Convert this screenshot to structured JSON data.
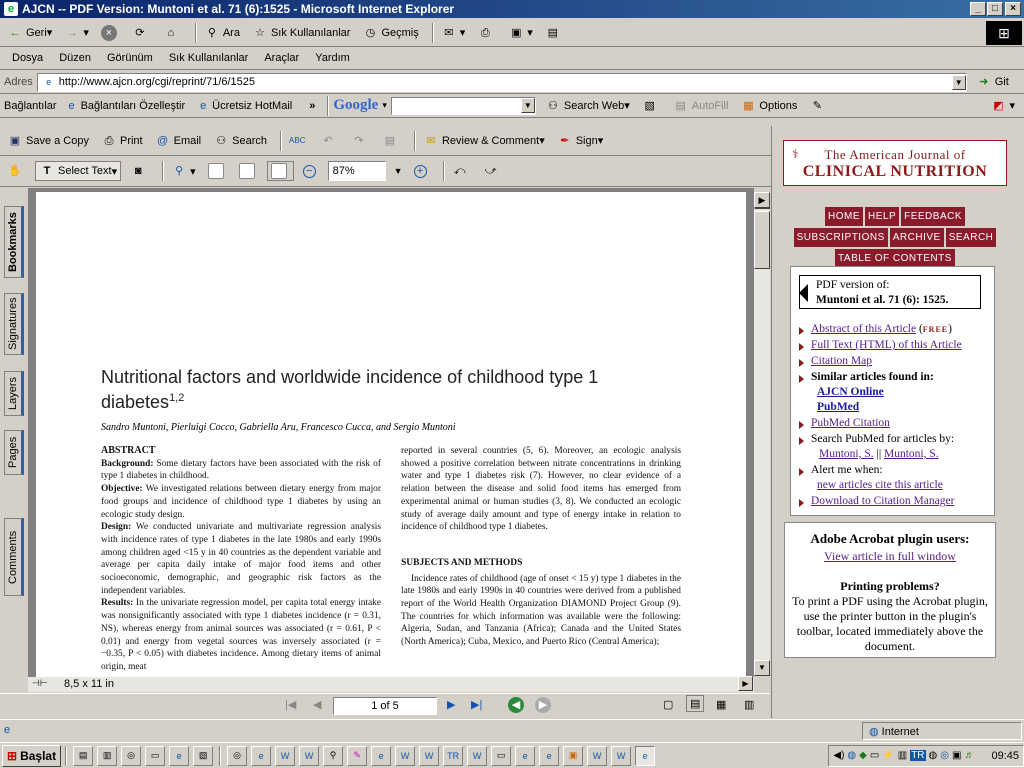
{
  "window": {
    "title": "AJCN -- PDF Version: Muntoni et al. 71 (6):1525 - Microsoft Internet Explorer"
  },
  "toolbar": {
    "back": "Geri",
    "search": "Ara",
    "favorites": "Sık Kullanılanlar",
    "history": "Geçmiş"
  },
  "menu": [
    "Dosya",
    "Düzen",
    "Görünüm",
    "Sık Kullanılanlar",
    "Araçlar",
    "Yardım"
  ],
  "address": {
    "label": "Adres",
    "url": "http://www.ajcn.org/cgi/reprint/71/6/1525",
    "go": "Git"
  },
  "links": {
    "label": "Bağlantılar",
    "customize": "Bağlantıları Özelleştir",
    "hotmail": "Ücretsiz HotMail",
    "google": "Google",
    "search_web": "Search Web",
    "autofill": "AutoFill",
    "options": "Options"
  },
  "acrobat": {
    "save": "Save a Copy",
    "print": "Print",
    "email": "Email",
    "search": "Search",
    "review": "Review & Comment",
    "sign": "Sign",
    "select_text": "Select Text",
    "zoom": "87%"
  },
  "side_tabs": [
    "Bookmarks",
    "Signatures",
    "Layers",
    "Pages",
    "Comments"
  ],
  "pdf": {
    "title": "Nutritional factors and worldwide incidence of childhood type 1 diabetes",
    "title_sup": "1,2",
    "authors": "Sandro Muntoni, Pierluigi Cocco, Gabriella Aru, Francesco Cucca, and Sergio Muntoni",
    "abstract_head": "ABSTRACT",
    "bg_label": "Background:",
    "bg": " Some dietary factors have been associated with the risk of type 1 diabetes in childhood.",
    "obj_label": "Objective:",
    "obj": " We investigated relations between dietary energy from major food groups and incidence of childhood type 1 diabetes by using an ecologic study design.",
    "design_label": "Design:",
    "design": " We conducted univariate and multivariate regression analysis with incidence rates of type 1 diabetes in the late 1980s and early 1990s among children aged <15 y in 40 countries as the dependent variable and average per capita daily intake of major food items and other socioeconomic, demographic, and geographic risk factors as the independent variables.",
    "results_label": "Results:",
    "results": " In the univariate regression model, per capita total energy intake was nonsignificantly associated with type 1 diabetes incidence (r = 0.31, NS), whereas energy from animal sources was associated (r = 0.61, P < 0.01) and energy from vegetal sources was inversely associated (r = −0.35, P < 0.05) with diabetes incidence. Among dietary items of animal origin, meat",
    "col2_p1": "reported in several countries (5, 6). Moreover, an ecologic analysis showed a positive correlation between nitrate concentrations in drinking water and type 1 diabetes risk (7). However, no clear evidence of a relation between the disease and solid food items has emerged from experimental animal or human studies (3, 8). We conducted an ecologic study of average daily amount and type of energy intake in relation to incidence of childhood type 1 diabetes.",
    "methods_head": "SUBJECTS AND METHODS",
    "col2_p2": "Incidence rates of childhood (age of onset < 15 y) type 1 diabetes in the late 1980s and early 1990s in 40 countries were derived from a published report of the World Health Organization DIAMOND Project Group (9). The countries for which information was available were the following: Algeria, Sudan, and Tanzania (Africa); Canada and the United States (North America); Cuba, Mexico, and Puerto Rico (Central America);"
  },
  "page_size": "8,5 x 11 in",
  "page_indicator": "1 of 5",
  "right": {
    "journal_top": "The American Journal of",
    "journal_bottom": "CLINICAL NUTRITION",
    "nav": [
      "HOME",
      "HELP",
      "FEEDBACK",
      "SUBSCRIPTIONS",
      "ARCHIVE",
      "SEARCH",
      "TABLE OF CONTENTS"
    ],
    "pdf_version_label": "PDF version of:",
    "pdf_version": "Muntoni et al. 71 (6): 1525.",
    "abstract_link": "Abstract of this Article",
    "free": "FREE",
    "fulltext_link": "Full Text (HTML) of this Article",
    "citation_map": "Citation Map",
    "similar": "Similar articles found in:",
    "ajcn_online": "AJCN Online",
    "pubmed": "PubMed",
    "pubmed_citation": "PubMed Citation",
    "search_pubmed": "Search PubMed for articles by:",
    "author1": "Muntoni, S.",
    "author2": "Muntoni, S.",
    "alert": "Alert me when:",
    "new_articles": "new articles cite this article",
    "download": "Download to Citation Manager",
    "plugin_head": "Adobe Acrobat plugin users:",
    "view_full": "View article in full window",
    "printing_head": "Printing problems?",
    "printing_text": "To print a PDF using the Acrobat plugin, use the printer button in the plugin's toolbar, located immediately above the document."
  },
  "status": {
    "zone": "Internet"
  },
  "taskbar": {
    "start": "Başlat",
    "clock": "09:45"
  }
}
